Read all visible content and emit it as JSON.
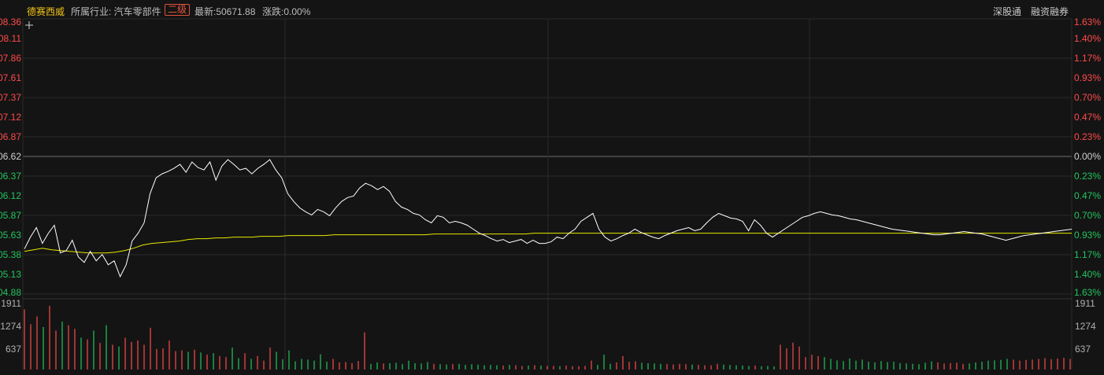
{
  "header": {
    "stock_name": "德赛西威",
    "industry_prefix": "所属行业: 汽车零部件",
    "industry_level": "二级",
    "latest_label": "最新:50671.88",
    "change_label": "涨跌:0.00%",
    "link_1": "深股通",
    "link_2": "融资融券"
  },
  "colors": {
    "background": "#141414",
    "price_line": "#ffffff",
    "avg_line": "#e8e800",
    "up": "#ff4a4a",
    "down": "#23c45e",
    "grid": "#2a2a2a"
  },
  "chart_data": [
    {
      "type": "line",
      "price_ticks": [
        "08.36",
        "08.11",
        "07.86",
        "07.61",
        "07.37",
        "07.12",
        "06.87",
        "06.62",
        "06.37",
        "06.12",
        "05.87",
        "05.63",
        "05.38",
        "05.13",
        "04.88"
      ],
      "pct_ticks": [
        "1.63%",
        "1.40%",
        "1.17%",
        "0.93%",
        "0.70%",
        "0.47%",
        "0.23%",
        "0.00%",
        "0.23%",
        "0.47%",
        "0.70%",
        "0.93%",
        "1.17%",
        "1.40%",
        "1.63%"
      ],
      "ylim": [
        4.88,
        8.36
      ],
      "reference": 6.62,
      "series": [
        {
          "values": [
            5.45,
            5.6,
            5.72,
            5.52,
            5.65,
            5.75,
            5.4,
            5.43,
            5.56,
            5.35,
            5.28,
            5.42,
            5.3,
            5.38,
            5.25,
            5.3,
            5.1,
            5.25,
            5.55,
            5.65,
            5.78,
            6.15,
            6.35,
            6.4,
            6.43,
            6.47,
            6.52,
            6.42,
            6.55,
            6.48,
            6.45,
            6.55,
            6.32,
            6.5,
            6.58,
            6.52,
            6.45,
            6.47,
            6.4,
            6.47,
            6.52,
            6.58,
            6.45,
            6.35,
            6.15,
            6.05,
            5.97,
            5.92,
            5.88,
            5.95,
            5.92,
            5.87,
            5.97,
            6.05,
            6.1,
            6.12,
            6.22,
            6.28,
            6.25,
            6.2,
            6.24,
            6.18,
            6.05,
            5.98,
            5.95,
            5.9,
            5.88,
            5.82,
            5.78,
            5.87,
            5.85,
            5.78,
            5.8,
            5.78,
            5.75,
            5.7,
            5.65,
            5.62,
            5.58,
            5.55,
            5.57,
            5.53,
            5.55,
            5.57,
            5.52,
            5.56,
            5.52,
            5.52,
            5.54,
            5.6,
            5.58,
            5.65,
            5.7,
            5.8,
            5.85,
            5.9,
            5.7,
            5.6,
            5.55,
            5.58,
            5.62,
            5.65,
            5.7,
            5.66,
            5.63,
            5.6,
            5.58,
            5.62,
            5.65,
            5.68,
            5.7,
            5.72,
            5.68,
            5.7,
            5.78,
            5.85,
            5.9,
            5.87,
            5.84,
            5.83,
            5.8,
            5.68,
            5.82,
            5.75,
            5.65,
            5.6,
            5.65,
            5.7,
            5.75,
            5.8,
            5.85,
            5.87,
            5.9,
            5.92,
            5.9,
            5.88,
            5.87,
            5.85,
            5.83,
            5.82,
            5.8,
            5.78,
            5.76,
            5.74,
            5.72,
            5.7,
            5.69,
            5.68,
            5.67,
            5.66,
            5.65,
            5.64,
            5.63,
            5.63,
            5.64,
            5.65,
            5.66,
            5.67,
            5.66,
            5.65,
            5.64,
            5.62,
            5.6,
            5.58,
            5.56,
            5.58,
            5.6,
            5.62,
            5.63,
            5.64,
            5.65,
            5.66,
            5.67,
            5.68,
            5.69,
            5.7
          ]
        },
        {
          "values": [
            5.42,
            5.44,
            5.46,
            5.44,
            5.43,
            5.42,
            5.41,
            5.4,
            5.4,
            5.4,
            5.41,
            5.43,
            5.46,
            5.5,
            5.52,
            5.53,
            5.54,
            5.55,
            5.57,
            5.58,
            5.58,
            5.59,
            5.59,
            5.6,
            5.6,
            5.6,
            5.61,
            5.61,
            5.61,
            5.62,
            5.62,
            5.62,
            5.62,
            5.62,
            5.63,
            5.63,
            5.63,
            5.63,
            5.63,
            5.63,
            5.63,
            5.63,
            5.63,
            5.63,
            5.63,
            5.64,
            5.64,
            5.64,
            5.64,
            5.64,
            5.64,
            5.64,
            5.64,
            5.64,
            5.64,
            5.64,
            5.65,
            5.65,
            5.65,
            5.65,
            5.65,
            5.65,
            5.65,
            5.65,
            5.65,
            5.65,
            5.65,
            5.65,
            5.65,
            5.65,
            5.65,
            5.65,
            5.65,
            5.65,
            5.65,
            5.65,
            5.65,
            5.65,
            5.65,
            5.65,
            5.65,
            5.65,
            5.65,
            5.65,
            5.65,
            5.65,
            5.65,
            5.65,
            5.65,
            5.65,
            5.65,
            5.65,
            5.65,
            5.65,
            5.65,
            5.65,
            5.65,
            5.65,
            5.65,
            5.65,
            5.65,
            5.65,
            5.65,
            5.65,
            5.65,
            5.65,
            5.65,
            5.65,
            5.65,
            5.65,
            5.65,
            5.65,
            5.65,
            5.65,
            5.65,
            5.65
          ]
        }
      ]
    },
    {
      "type": "bar",
      "ylim": [
        0,
        1911
      ],
      "ticks": [
        "1911",
        "1274",
        "637"
      ],
      "values": [
        1700,
        1280,
        1500,
        1200,
        1800,
        1100,
        1350,
        1250,
        1150,
        900,
        850,
        1100,
        750,
        1250,
        700,
        650,
        900,
        780,
        820,
        700,
        1180,
        580,
        600,
        820,
        520,
        540,
        500,
        560,
        480,
        420,
        460,
        380,
        350,
        620,
        320,
        460,
        300,
        380,
        250,
        620,
        500,
        290,
        540,
        230,
        300,
        280,
        250,
        430,
        220,
        300,
        200,
        210,
        180,
        240,
        1050,
        160,
        200,
        170,
        180,
        190,
        150,
        250,
        180,
        170,
        210,
        160,
        150,
        140,
        150,
        160,
        130,
        150,
        140,
        120,
        130,
        120,
        110,
        130,
        120,
        100,
        110,
        120,
        110,
        100,
        100,
        95,
        110,
        95,
        90,
        100,
        250,
        130,
        420,
        160,
        200,
        380,
        220,
        230,
        190,
        180,
        170,
        160,
        150,
        140,
        160,
        150,
        140,
        130,
        120,
        120,
        160,
        140,
        130,
        120,
        110,
        100,
        110,
        90,
        100,
        90,
        700,
        600,
        760,
        650,
        350,
        420,
        380,
        350,
        300,
        260,
        240,
        310,
        250,
        280,
        220,
        200,
        240,
        210,
        220,
        180,
        170,
        160,
        150,
        190,
        230,
        200,
        170,
        180,
        190,
        160,
        170,
        200,
        220,
        250,
        260,
        270,
        300,
        280,
        250,
        270,
        280,
        300,
        320,
        290,
        310,
        330,
        300
      ]
    }
  ]
}
